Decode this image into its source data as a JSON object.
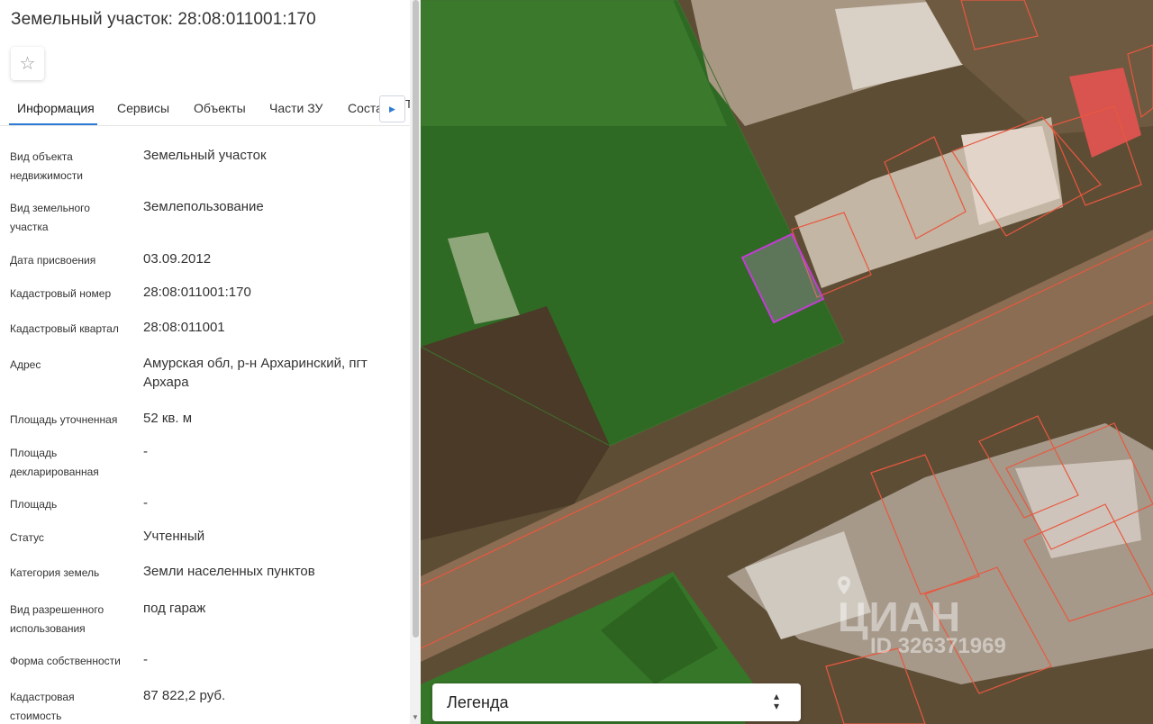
{
  "panel": {
    "title": "Земельный участок: 28:08:011001:170",
    "favorite_icon": "star-outline",
    "tabs": [
      {
        "label": "Информация",
        "active": true
      },
      {
        "label": "Сервисы",
        "active": false
      },
      {
        "label": "Объекты",
        "active": false
      },
      {
        "label": "Части ЗУ",
        "active": false
      },
      {
        "label": "Соста",
        "active": false
      }
    ],
    "tab_overflow_char": "Т",
    "tab_scroll_icon": "triangle-right",
    "accent_color": "#2e7bd6",
    "rows": [
      {
        "label": "Вид объекта недвижимости",
        "value": "Земельный участок"
      },
      {
        "label": "Вид земельного участка",
        "value": "Землепользование"
      },
      {
        "label": "Дата присвоения",
        "value": "03.09.2012"
      },
      {
        "label": "Кадастровый номер",
        "value": "28:08:011001:170"
      },
      {
        "label": "Кадастровый квартал",
        "value": "28:08:011001"
      },
      {
        "label": "Адрес",
        "value": "Амурская обл, р-н Архаринский, пгт Архара"
      },
      {
        "label": "Площадь уточненная",
        "value": "52 кв. м"
      },
      {
        "label": "Площадь декларированная",
        "value": "-"
      },
      {
        "label": "Площадь",
        "value": "-"
      },
      {
        "label": "Статус",
        "value": "Учтенный"
      },
      {
        "label": "Категория земель",
        "value": "Земли населенных пунктов"
      },
      {
        "label": "Вид разрешенного использования",
        "value": "под гараж"
      },
      {
        "label": "Форма собственности",
        "value": "-"
      },
      {
        "label": "Кадастровая стоимость",
        "value": "87 822,2 руб."
      }
    ]
  },
  "map": {
    "legend_label": "Легенда",
    "legend_toggle_icon": "chevron-up-down",
    "watermark_logo": "ЦИАН",
    "watermark_id": "ID 326371969",
    "parcel_outline_color": "#e8583f",
    "selected_parcel_color": "#c43bd6"
  }
}
